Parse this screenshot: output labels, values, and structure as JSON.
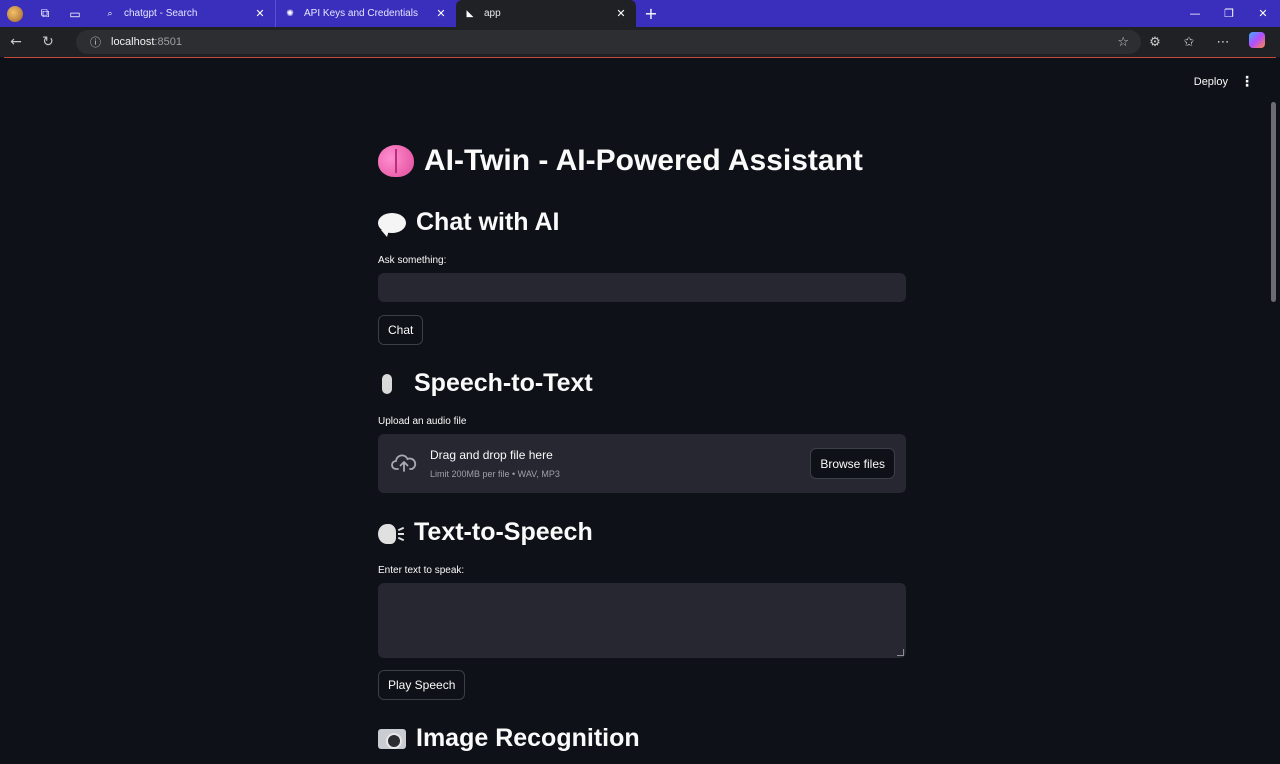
{
  "browser": {
    "tabs": [
      {
        "title": "chatgpt - Search",
        "favicon": "search-icon"
      },
      {
        "title": "API Keys and Credentials",
        "favicon": "openai-icon"
      },
      {
        "title": "app",
        "favicon": "streamlit-icon",
        "active": true
      }
    ],
    "address": {
      "host": "localhost",
      "port": ":8501"
    }
  },
  "app": {
    "toolbar": {
      "deploy_label": "Deploy"
    },
    "title": "AI-Twin - AI-Powered Assistant",
    "chat": {
      "heading": "Chat with AI",
      "input_label": "Ask something:",
      "input_value": "",
      "button_label": "Chat"
    },
    "stt": {
      "heading": "Speech-to-Text",
      "upload_label": "Upload an audio file",
      "drop_title": "Drag and drop file here",
      "drop_limits": "Limit 200MB per file • WAV, MP3",
      "browse_label": "Browse files"
    },
    "tts": {
      "heading": "Text-to-Speech",
      "input_label": "Enter text to speak:",
      "input_value": "",
      "button_label": "Play Speech"
    },
    "image": {
      "heading": "Image Recognition"
    }
  },
  "colors": {
    "tabbar": "#3a2fbd",
    "background": "#0e1117",
    "input_bg": "#262730",
    "text": "#fafafa"
  }
}
